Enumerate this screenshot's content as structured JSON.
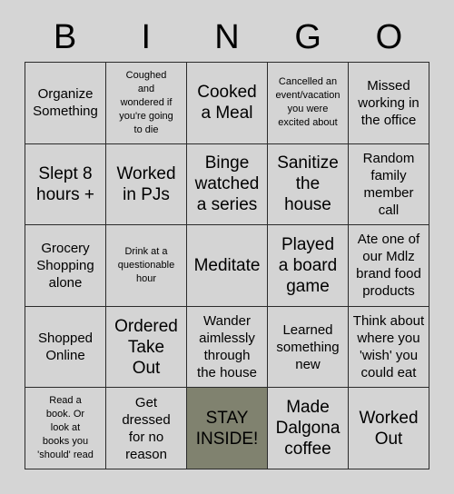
{
  "card": {
    "title": "BINGO",
    "header_letters": [
      "B",
      "I",
      "N",
      "G",
      "O"
    ],
    "colors": {
      "page_background": "#d5d5d5",
      "cell_background": "#d4d4d4",
      "free_space_background": "#80826f",
      "border": "#2b2b2b",
      "text": "#000000"
    },
    "rows": [
      [
        {
          "text": "Organize\nSomething",
          "size": "md",
          "free": false
        },
        {
          "text": "Coughed\nand\nwondered if\nyou're going\nto die",
          "size": "sm",
          "free": false
        },
        {
          "text": "Cooked\na Meal",
          "size": "lg",
          "free": false
        },
        {
          "text": "Cancelled an\nevent/vacation\nyou were\nexcited about",
          "size": "sm",
          "free": false
        },
        {
          "text": "Missed\nworking in\nthe office",
          "size": "md",
          "free": false
        }
      ],
      [
        {
          "text": "Slept 8\nhours +",
          "size": "lg",
          "free": false
        },
        {
          "text": "Worked\nin PJs",
          "size": "lg",
          "free": false
        },
        {
          "text": "Binge\nwatched\na series",
          "size": "lg",
          "free": false
        },
        {
          "text": "Sanitize\nthe\nhouse",
          "size": "lg",
          "free": false
        },
        {
          "text": "Random\nfamily\nmember\ncall",
          "size": "md",
          "free": false
        }
      ],
      [
        {
          "text": "Grocery\nShopping\nalone",
          "size": "md",
          "free": false
        },
        {
          "text": "Drink at a\nquestionable\nhour",
          "size": "sm",
          "free": false
        },
        {
          "text": "Meditate",
          "size": "lg",
          "free": false
        },
        {
          "text": "Played\na board\ngame",
          "size": "lg",
          "free": false
        },
        {
          "text": "Ate one of\nour Mdlz\nbrand food\nproducts",
          "size": "md",
          "free": false
        }
      ],
      [
        {
          "text": "Shopped\nOnline",
          "size": "md",
          "free": false
        },
        {
          "text": "Ordered\nTake\nOut",
          "size": "lg",
          "free": false
        },
        {
          "text": "Wander\naimlessly\nthrough\nthe house",
          "size": "md",
          "free": false
        },
        {
          "text": "Learned\nsomething\nnew",
          "size": "md",
          "free": false
        },
        {
          "text": "Think about\nwhere you\n'wish' you\ncould eat",
          "size": "md",
          "free": false
        }
      ],
      [
        {
          "text": "Read a\nbook. Or\nlook at\nbooks you\n'should' read",
          "size": "sm",
          "free": false
        },
        {
          "text": "Get\ndressed\nfor no\nreason",
          "size": "md",
          "free": false
        },
        {
          "text": "STAY\nINSIDE!",
          "size": "lg",
          "free": true
        },
        {
          "text": "Made\nDalgona\ncoffee",
          "size": "lg",
          "free": false
        },
        {
          "text": "Worked\nOut",
          "size": "lg",
          "free": false
        }
      ]
    ]
  }
}
